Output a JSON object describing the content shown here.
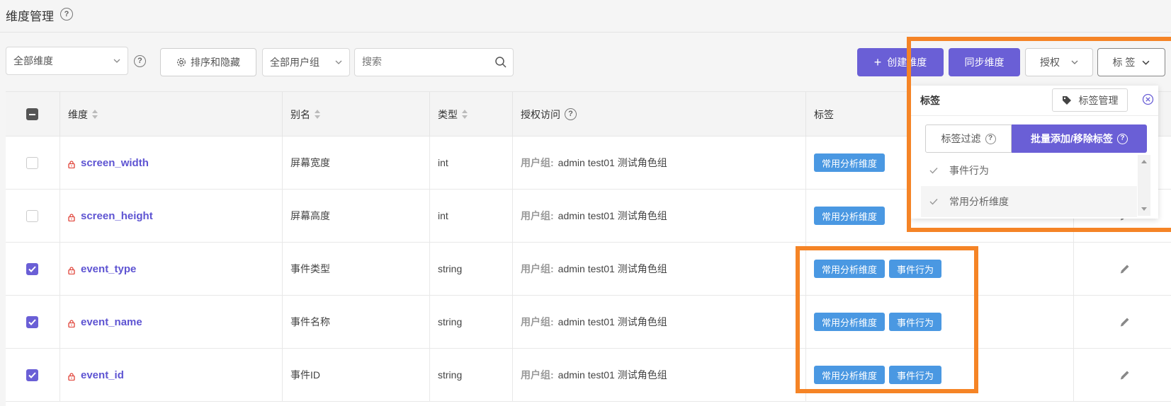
{
  "header": {
    "title": "维度管理"
  },
  "toolbar": {
    "dimension_filter": "全部维度",
    "sort_hide": "排序和隐藏",
    "user_group_filter": "全部用户组",
    "search_placeholder": "搜索",
    "create": "创建维度",
    "create_plus": "+",
    "sync": "同步维度",
    "authorize": "授权",
    "tags": "标 签"
  },
  "table": {
    "headers": {
      "dimension": "维度",
      "alias": "别名",
      "type": "类型",
      "access": "授权访问",
      "tags": "标签"
    },
    "rows": [
      {
        "name": "screen_width",
        "alias": "屏幕宽度",
        "type": "int",
        "access_label": "用户组:",
        "access_value": "admin test01 测试角色组",
        "tags": [
          "常用分析维度"
        ],
        "checked": false
      },
      {
        "name": "screen_height",
        "alias": "屏幕高度",
        "type": "int",
        "access_label": "用户组:",
        "access_value": "admin test01 测试角色组",
        "tags": [
          "常用分析维度"
        ],
        "checked": false
      },
      {
        "name": "event_type",
        "alias": "事件类型",
        "type": "string",
        "access_label": "用户组:",
        "access_value": "admin test01 测试角色组",
        "tags": [
          "常用分析维度",
          "事件行为"
        ],
        "checked": true
      },
      {
        "name": "event_name",
        "alias": "事件名称",
        "type": "string",
        "access_label": "用户组:",
        "access_value": "admin test01 测试角色组",
        "tags": [
          "常用分析维度",
          "事件行为"
        ],
        "checked": true
      },
      {
        "name": "event_id",
        "alias": "事件ID",
        "type": "string",
        "access_label": "用户组:",
        "access_value": "admin test01 测试角色组",
        "tags": [
          "常用分析维度",
          "事件行为"
        ],
        "checked": true
      }
    ]
  },
  "tag_dropdown": {
    "title": "标签",
    "manage": "标签管理",
    "filter": "标签过滤",
    "batch": "批量添加/移除标签",
    "items": [
      "事件行为",
      "常用分析维度"
    ]
  },
  "colors": {
    "primary": "#6a5fd6",
    "tag_blue": "#4a98e2",
    "highlight_orange": "#f58426",
    "lock_red": "#e0443a"
  }
}
